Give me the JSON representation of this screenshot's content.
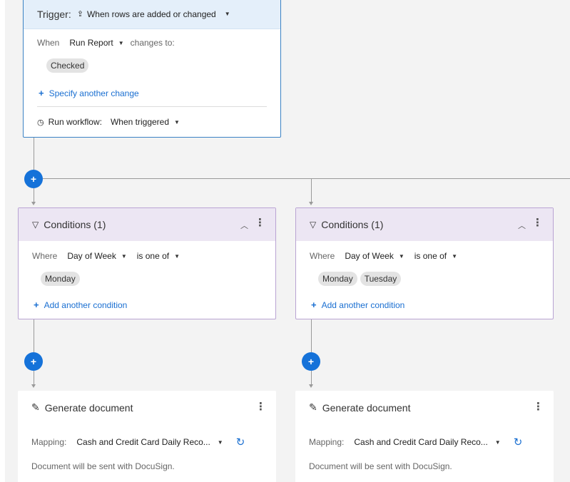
{
  "trigger": {
    "label": "Trigger:",
    "event": "When rows are added or changed",
    "when_label": "When",
    "field": "Run Report",
    "changes_to": "changes to:",
    "value_chip": "Checked",
    "specify_link": "Specify another change",
    "run_workflow_label": "Run workflow:",
    "run_workflow_value": "When triggered"
  },
  "add_button_label": "+",
  "branches": [
    {
      "conditions": {
        "title": "Conditions (1)",
        "where_label": "Where",
        "field": "Day of Week",
        "operator": "is one of",
        "chips": [
          "Monday"
        ],
        "add_link": "Add another condition"
      },
      "action": {
        "title": "Generate document",
        "mapping_label": "Mapping:",
        "mapping_value": "Cash and Credit Card Daily Reco...",
        "note": "Document will be sent with DocuSign."
      }
    },
    {
      "conditions": {
        "title": "Conditions (1)",
        "where_label": "Where",
        "field": "Day of Week",
        "operator": "is one of",
        "chips": [
          "Monday",
          "Tuesday"
        ],
        "add_link": "Add another condition"
      },
      "action": {
        "title": "Generate document",
        "mapping_label": "Mapping:",
        "mapping_value": "Cash and Credit Card Daily Reco...",
        "note": "Document will be sent with DocuSign."
      }
    }
  ],
  "colors": {
    "accent": "#1572d9",
    "trigger_border": "#3b82c4",
    "trigger_header": "#e4effa",
    "condition_border": "#b9a3d3",
    "condition_header": "#ece6f3",
    "connector": "#9a9a9a"
  }
}
